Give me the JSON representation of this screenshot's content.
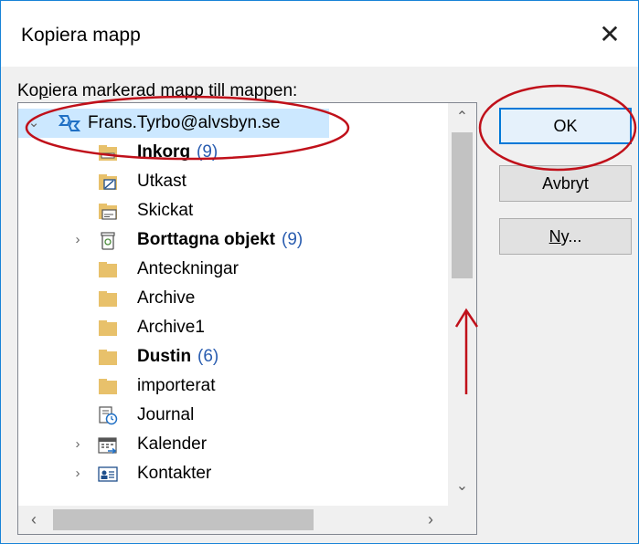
{
  "dialog": {
    "title": "Kopiera mapp",
    "close_symbol": "✕",
    "prompt_prefix": "Ko",
    "prompt_accel": "p",
    "prompt_suffix": "iera markerad mapp till mappen:"
  },
  "tree": {
    "account": {
      "label": "Frans.Tyrbo@alvsbyn.se",
      "icon": "account-icon",
      "expanded": true
    },
    "items": [
      {
        "label": "Inkorg",
        "count": "(9)",
        "bold": true,
        "icon": "inbox-folder-icon",
        "expandable": false
      },
      {
        "label": "Utkast",
        "count": "",
        "bold": false,
        "icon": "drafts-folder-icon",
        "expandable": false
      },
      {
        "label": "Skickat",
        "count": "",
        "bold": false,
        "icon": "sent-folder-icon",
        "expandable": false
      },
      {
        "label": "Borttagna objekt",
        "count": "(9)",
        "bold": true,
        "icon": "trash-icon",
        "expandable": true
      },
      {
        "label": "Anteckningar",
        "count": "",
        "bold": false,
        "icon": "notes-folder-icon",
        "expandable": false
      },
      {
        "label": "Archive",
        "count": "",
        "bold": false,
        "icon": "folder-icon",
        "expandable": false
      },
      {
        "label": "Archive1",
        "count": "",
        "bold": false,
        "icon": "folder-icon",
        "expandable": false
      },
      {
        "label": "Dustin",
        "count": "(6)",
        "bold": true,
        "icon": "folder-icon",
        "expandable": false
      },
      {
        "label": "importerat",
        "count": "",
        "bold": false,
        "icon": "folder-icon",
        "expandable": false
      },
      {
        "label": "Journal",
        "count": "",
        "bold": false,
        "icon": "journal-icon",
        "expandable": false
      },
      {
        "label": "Kalender",
        "count": "",
        "bold": false,
        "icon": "calendar-icon",
        "expandable": true
      },
      {
        "label": "Kontakter",
        "count": "",
        "bold": false,
        "icon": "contacts-icon",
        "expandable": true
      }
    ]
  },
  "scrollbars": {
    "up": "⌃",
    "down": "⌄",
    "left": "‹",
    "right": "›"
  },
  "buttons": {
    "ok": "OK",
    "cancel": "Avbryt",
    "new_prefix": "",
    "new_accel": "N",
    "new_suffix": "y..."
  },
  "colors": {
    "accent": "#0078d7",
    "selection": "#cce8ff",
    "count": "#2a5db0",
    "folder": "#e8c16b",
    "annotation": "#c0101a"
  }
}
